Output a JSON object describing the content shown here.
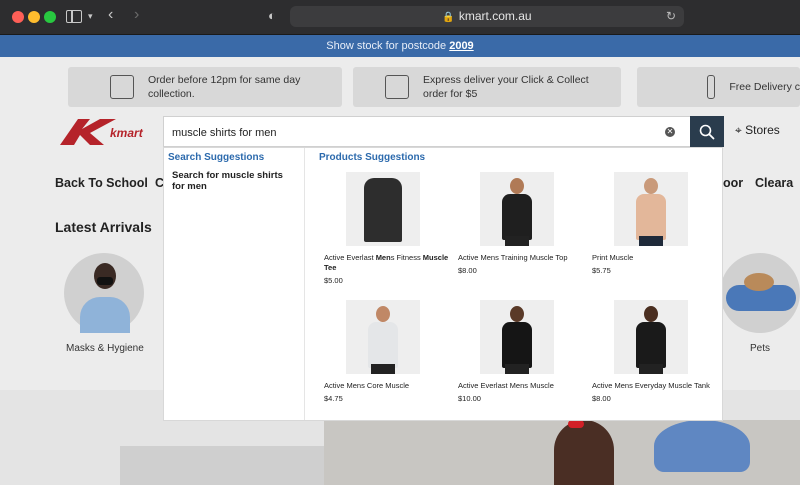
{
  "browser": {
    "url": "kmart.com.au"
  },
  "promo": {
    "text": "Show stock for postcode",
    "postcode": "2009"
  },
  "info_boxes": [
    {
      "text": "Order before 12pm for same day collection."
    },
    {
      "text": "Express deliver your Click & Collect order for $5"
    },
    {
      "text": "Free Delivery c"
    }
  ],
  "header": {
    "logo_text": "kmart",
    "stores_label": "Stores"
  },
  "nav": {
    "items": [
      "Back To School",
      "C",
      "oor",
      "Cleara"
    ]
  },
  "latest": {
    "title": "Latest Arrivals",
    "categories": [
      "Masks & Hygiene",
      "Pets"
    ]
  },
  "search": {
    "query": "muscle shirts for men",
    "search_suggestions_title": "Search Suggestions",
    "suggestion_prefix": "Search for ",
    "suggestion_query": "muscle shirts for men",
    "products_title": "Products Suggestions"
  },
  "products": [
    {
      "name_pre": "Active Everlast ",
      "name_bold": "Men",
      "name_mid": "s Fitness ",
      "name_bold2": "Muscle Tee",
      "price": "$5.00",
      "shirt_color": "#2e2e2e",
      "type": "shirt"
    },
    {
      "name": "Active Mens Training Muscle Top",
      "price": "$8.00",
      "shirt_color": "#1f1f1f",
      "type": "person"
    },
    {
      "name": "Print Muscle",
      "price": "$5.75",
      "shirt_color": "#e3b79a",
      "type": "person"
    },
    {
      "name": "Active Mens Core Muscle",
      "price": "$4.75",
      "shirt_color": "#e4e6e8",
      "type": "person"
    },
    {
      "name": "Active Everlast Mens Muscle",
      "price": "$10.00",
      "shirt_color": "#151515",
      "type": "person"
    },
    {
      "name": "Active Mens Everyday Muscle Tank",
      "price": "$8.00",
      "shirt_color": "#1a1a1a",
      "type": "person"
    }
  ],
  "colors": {
    "accent": "#2c6aad",
    "search_button": "#2a3c4d",
    "promo_bar": "#3a6aa8",
    "kmart_red": "#d22027"
  }
}
